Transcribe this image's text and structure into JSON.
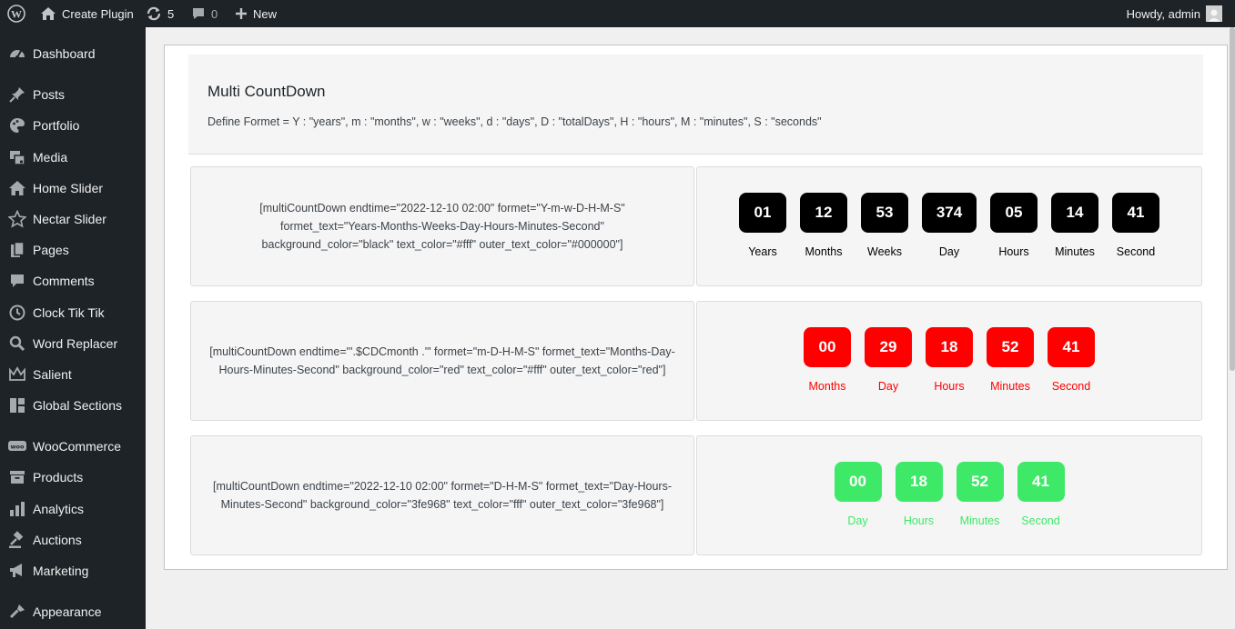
{
  "adminbar": {
    "site_name": "Create Plugin",
    "updates_count": "5",
    "comments_count": "0",
    "new_label": "New",
    "howdy": "Howdy, admin"
  },
  "sidebar": {
    "items": [
      {
        "label": "Dashboard",
        "icon": "dashboard-icon"
      },
      {
        "label": "Posts",
        "icon": "pin-icon"
      },
      {
        "label": "Portfolio",
        "icon": "palette-icon"
      },
      {
        "label": "Media",
        "icon": "media-icon"
      },
      {
        "label": "Home Slider",
        "icon": "home-icon"
      },
      {
        "label": "Nectar Slider",
        "icon": "star-icon"
      },
      {
        "label": "Pages",
        "icon": "pages-icon"
      },
      {
        "label": "Comments",
        "icon": "comment-icon"
      },
      {
        "label": "Clock Tik Tik",
        "icon": "clock-icon"
      },
      {
        "label": "Word Replacer",
        "icon": "search-icon"
      },
      {
        "label": "Salient",
        "icon": "crown-icon"
      },
      {
        "label": "Global Sections",
        "icon": "grid-icon"
      },
      {
        "label": "WooCommerce",
        "icon": "woo-icon"
      },
      {
        "label": "Products",
        "icon": "archive-icon"
      },
      {
        "label": "Analytics",
        "icon": "bar-chart-icon"
      },
      {
        "label": "Auctions",
        "icon": "gavel-icon"
      },
      {
        "label": "Marketing",
        "icon": "megaphone-icon"
      },
      {
        "label": "Appearance",
        "icon": "brush-icon"
      }
    ]
  },
  "main": {
    "title": "Multi CountDown",
    "format_text": "Define Formet = Y : \"years\", m : \"months\", w : \"weeks\", d : \"days\", D : \"totalDays\", H : \"hours\", M : \"minutes\", S : \"seconds\"",
    "rows": [
      {
        "shortcode": "[multiCountDown endtime=\"2022-12-10 02:00\" formet=\"Y-m-w-D-H-M-S\" formet_text=\"Years-Months-Weeks-Day-Hours-Minutes-Second\" background_color=\"black\" text_color=\"#fff\" outer_text_color=\"#000000\"]",
        "box_color": "#000000",
        "text_color": "#ffffff",
        "label_color": "#000000",
        "units": [
          {
            "value": "01",
            "label": "Years"
          },
          {
            "value": "12",
            "label": "Months"
          },
          {
            "value": "53",
            "label": "Weeks"
          },
          {
            "value": "374",
            "label": "Day"
          },
          {
            "value": "05",
            "label": "Hours"
          },
          {
            "value": "14",
            "label": "Minutes"
          },
          {
            "value": "41",
            "label": "Second"
          }
        ]
      },
      {
        "shortcode": "[multiCountDown endtime=\"'.$CDCmonth .'\" formet=\"m-D-H-M-S\" formet_text=\"Months-Day-Hours-Minutes-Second\" background_color=\"red\" text_color=\"#fff\" outer_text_color=\"red\"]",
        "box_color": "#ff0000",
        "text_color": "#ffffff",
        "label_color": "#ff0000",
        "units": [
          {
            "value": "00",
            "label": "Months"
          },
          {
            "value": "29",
            "label": "Day"
          },
          {
            "value": "18",
            "label": "Hours"
          },
          {
            "value": "52",
            "label": "Minutes"
          },
          {
            "value": "41",
            "label": "Second"
          }
        ]
      },
      {
        "shortcode": "[multiCountDown endtime=\"2022-12-10 02:00\" formet=\"D-H-M-S\" formet_text=\"Day-Hours-Minutes-Second\" background_color=\"3fe968\" text_color=\"fff\" outer_text_color=\"3fe968\"]",
        "box_color": "#3fe968",
        "text_color": "#ffffff",
        "label_color": "#3fe968",
        "units": [
          {
            "value": "00",
            "label": "Day"
          },
          {
            "value": "18",
            "label": "Hours"
          },
          {
            "value": "52",
            "label": "Minutes"
          },
          {
            "value": "41",
            "label": "Second"
          }
        ]
      }
    ]
  }
}
